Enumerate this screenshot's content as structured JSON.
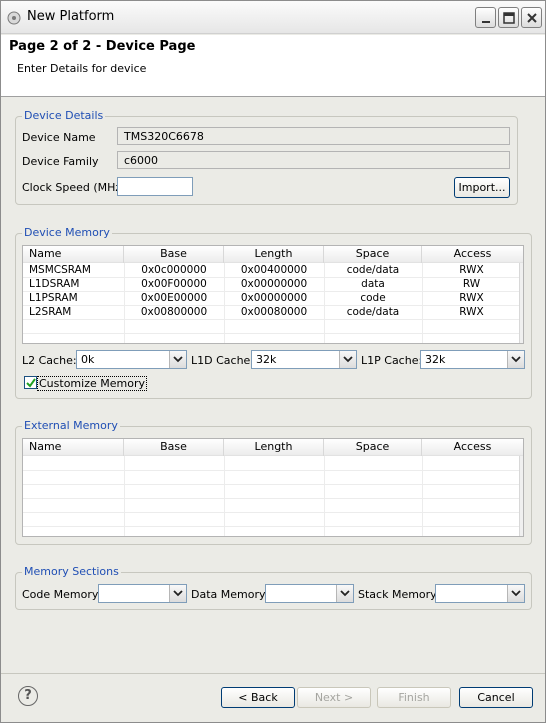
{
  "window": {
    "title": "New Platform",
    "controls": [
      "minimize-icon",
      "maximize-icon",
      "close-icon"
    ]
  },
  "header": {
    "title": "Page 2 of 2 - Device Page",
    "subtitle": "Enter Details for device"
  },
  "device_details": {
    "legend": "Device Details",
    "device_name_label": "Device Name",
    "device_name_value": "TMS320C6678",
    "device_family_label": "Device Family",
    "device_family_value": "c6000",
    "clock_speed_label": "Clock Speed (MHz)",
    "clock_speed_value": "",
    "import_label": "Import..."
  },
  "device_memory": {
    "legend": "Device Memory",
    "columns": [
      "Name",
      "Base",
      "Length",
      "Space",
      "Access"
    ],
    "rows": [
      {
        "name": "MSMCSRAM",
        "base": "0x0c000000",
        "length": "0x00400000",
        "space": "code/data",
        "access": "RWX"
      },
      {
        "name": "L1DSRAM",
        "base": "0x00F00000",
        "length": "0x00000000",
        "space": "data",
        "access": "RW"
      },
      {
        "name": "L1PSRAM",
        "base": "0x00E00000",
        "length": "0x00000000",
        "space": "code",
        "access": "RWX"
      },
      {
        "name": "L2SRAM",
        "base": "0x00800000",
        "length": "0x00080000",
        "space": "code/data",
        "access": "RWX"
      }
    ],
    "l2_cache_label": "L2 Cache:",
    "l2_cache_value": "0k",
    "l1d_cache_label": "L1D Cache:",
    "l1d_cache_value": "32k",
    "l1p_cache_label": "L1P Cache:",
    "l1p_cache_value": "32k",
    "customize_label": "Customize Memory",
    "customize_checked": true
  },
  "external_memory": {
    "legend": "External Memory",
    "columns": [
      "Name",
      "Base",
      "Length",
      "Space",
      "Access"
    ]
  },
  "memory_sections": {
    "legend": "Memory Sections",
    "code_memory_label": "Code Memory:",
    "data_memory_label": "Data Memory:",
    "stack_memory_label": "Stack Memory:"
  },
  "footer": {
    "back_label": "< Back",
    "next_label": "Next >",
    "finish_label": "Finish",
    "cancel_label": "Cancel"
  }
}
